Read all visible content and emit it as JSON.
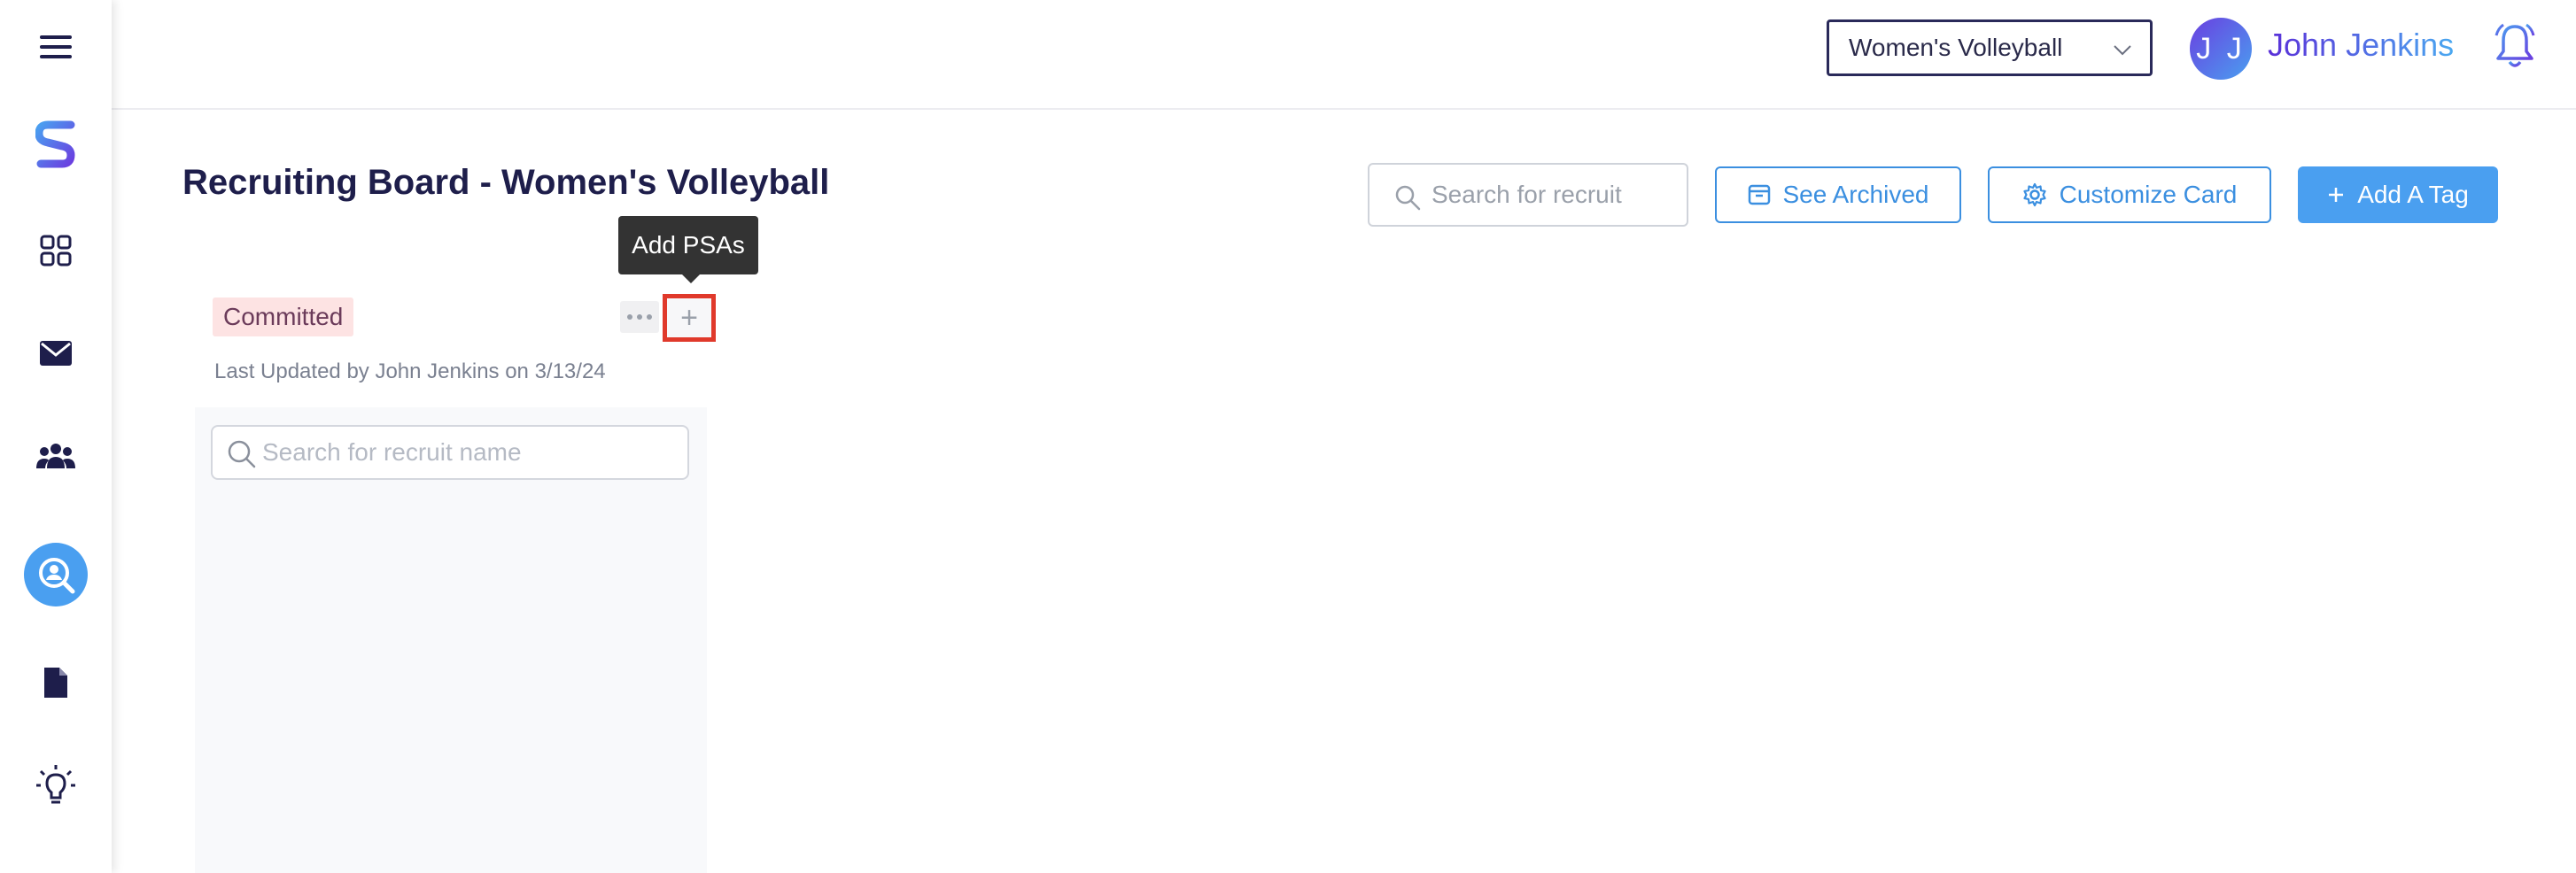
{
  "sidebar": {
    "items": [
      {
        "icon": "hamburger-menu-icon"
      },
      {
        "icon": "brand-logo-icon"
      },
      {
        "icon": "dashboard-grid-icon"
      },
      {
        "icon": "envelope-icon"
      },
      {
        "icon": "people-group-icon"
      },
      {
        "icon": "recruit-search-icon",
        "active": true
      },
      {
        "icon": "document-icon"
      },
      {
        "icon": "lightbulb-icon"
      }
    ]
  },
  "header": {
    "sport_selected": "Women's Volleyball",
    "avatar_initials": "J J",
    "user_name": "John Jenkins"
  },
  "page": {
    "title": "Recruiting Board - Women's Volleyball"
  },
  "toolbar": {
    "search_placeholder": "Search for recruit",
    "see_archived_label": "See Archived",
    "customize_card_label": "Customize Card",
    "add_tag_label": "Add A Tag"
  },
  "tooltip": {
    "text": "Add PSAs"
  },
  "column": {
    "tag_label": "Committed",
    "last_updated": "Last Updated by John Jenkins on 3/13/24",
    "search_placeholder": "Search for recruit name",
    "add_symbol": "+"
  },
  "colors": {
    "accent": "#4a9ff0",
    "navy": "#1e1e4b",
    "tag_bg": "#fde3e3",
    "highlight": "#e0392b"
  }
}
